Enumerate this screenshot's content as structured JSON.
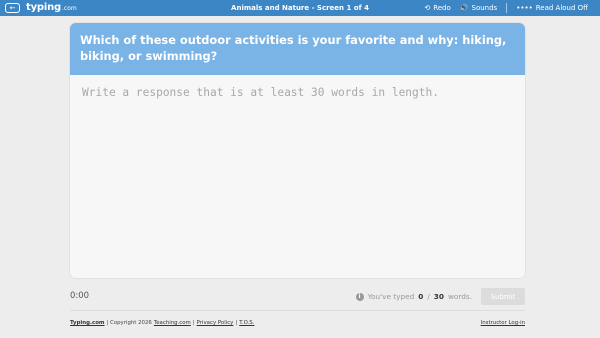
{
  "topbar": {
    "back_icon": "←",
    "logo_main": "typing",
    "logo_sub": ".com",
    "title": "Animals and Nature - Screen 1 of 4",
    "redo_label": "Redo",
    "redo_icon": "⟲",
    "sounds_label": "Sounds",
    "sounds_icon": "🔊",
    "read_aloud_label": "Read Aloud Off",
    "read_aloud_icon": "••••",
    "bar_color": "#3d86c6"
  },
  "prompt": {
    "text": "Which of these outdoor activities is your favorite and why: hiking, biking, or swimming?",
    "bg_color": "#7ab3e6"
  },
  "response": {
    "placeholder": "Write a response that is at least 30 words in length.",
    "value": ""
  },
  "status": {
    "timer": "0:00",
    "info_icon": "i",
    "typed_prefix": "You've typed",
    "typed_count": "0",
    "typed_sep": "/",
    "typed_target": "30",
    "typed_suffix": "words.",
    "submit_label": "Submit"
  },
  "footer": {
    "brand": "Typing.com",
    "copyright": "| Copyright 2026",
    "teaching": "Teaching.com",
    "sep1": "|",
    "privacy": "Privacy Policy",
    "sep2": "|",
    "tos": "T.O.S.",
    "instructor": "Instructor Log-in"
  }
}
